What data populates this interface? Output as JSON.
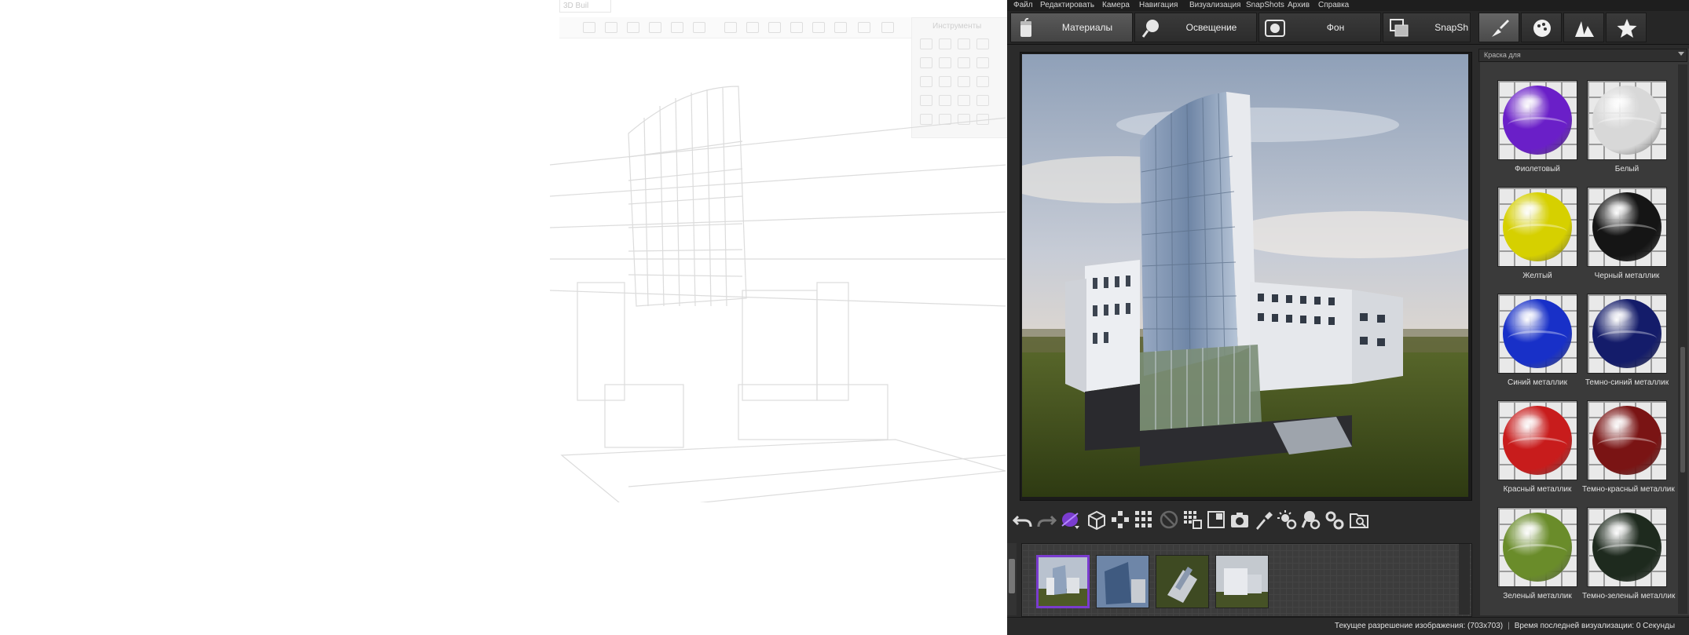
{
  "background_app": {
    "tab_label": "3D Buil",
    "tools_panel_title": "Инструменты"
  },
  "menu": [
    "Файл",
    "Редактировать",
    "Камера",
    "Навигация",
    "Визуализация",
    "SnapShots",
    "Архив",
    "Справка"
  ],
  "tabs": [
    {
      "label": "Материалы",
      "icon": "paint-bucket-icon",
      "active": true
    },
    {
      "label": "Освещение",
      "icon": "lamp-icon",
      "active": false
    },
    {
      "label": "Фон",
      "icon": "background-icon",
      "active": false
    },
    {
      "label": "SnapSh",
      "icon": "snapshot-icon",
      "active": false
    }
  ],
  "panel_tabs": [
    {
      "icon": "paint-brush-icon",
      "active": true
    },
    {
      "icon": "ball-icon",
      "active": false
    },
    {
      "icon": "mountains-icon",
      "active": false
    },
    {
      "icon": "star-icon",
      "active": false
    }
  ],
  "material_dropdown": {
    "value": "Краска для"
  },
  "materials": [
    {
      "label": "Фиолетовый",
      "color": "#6a1fc8"
    },
    {
      "label": "Белый",
      "color": "#d8d8d8"
    },
    {
      "label": "Желтый",
      "color": "#d6d000"
    },
    {
      "label": "Черный металлик",
      "color": "#151515"
    },
    {
      "label": "Синий металлик",
      "color": "#1830c8"
    },
    {
      "label": "Темно-синий металлик",
      "color": "#141c6a"
    },
    {
      "label": "Красный металлик",
      "color": "#c81c1c"
    },
    {
      "label": "Темно-красный металлик",
      "color": "#7a1414"
    },
    {
      "label": "Зеленый металлик",
      "color": "#6a8c2a"
    },
    {
      "label": "Темно-зеленый металлик",
      "color": "#1e2a1e"
    }
  ],
  "toolbar": [
    "undo-icon",
    "redo-icon",
    "material-picker-icon",
    "box-icon",
    "move-points-icon",
    "grid-points-icon",
    "disabled-icon",
    "pattern-icon",
    "frame-icon",
    "camera-icon",
    "eyedropper-icon",
    "sun-settings-icon",
    "light-settings-icon",
    "gear-settings-icon",
    "search-folder-icon"
  ],
  "snapshots": {
    "count": 4,
    "selected": 0
  },
  "status": {
    "resolution": "Текущее разрешение изображения: (703x703)",
    "last_render": "Время последней визуализации: 0 Секунды"
  }
}
